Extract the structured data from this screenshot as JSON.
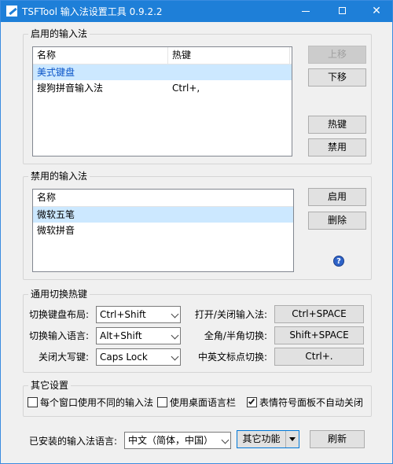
{
  "window": {
    "title": "TSFTool 输入法设置工具 0.9.2.2"
  },
  "enabled": {
    "legend": "启用的输入法",
    "columns": [
      "名称",
      "热键"
    ],
    "rows": [
      {
        "name": "美式键盘",
        "hotkey": ""
      },
      {
        "name": "搜狗拼音输入法",
        "hotkey": "Ctrl+,"
      }
    ],
    "buttons": {
      "up": "上移",
      "down": "下移",
      "hotkey": "热键",
      "disable": "禁用"
    }
  },
  "disabled": {
    "legend": "禁用的输入法",
    "column": "名称",
    "rows": [
      "微软五笔",
      "微软拼音"
    ],
    "buttons": {
      "enable": "启用",
      "delete": "删除"
    },
    "help": "?"
  },
  "hotkeys": {
    "legend": "通用切换热键",
    "left": [
      {
        "label": "切换键盘布局:",
        "value": "Ctrl+Shift"
      },
      {
        "label": "切换输入语言:",
        "value": "Alt+Shift"
      },
      {
        "label": "关闭大写键:",
        "value": "Caps Lock"
      }
    ],
    "right": [
      {
        "label": "打开/关闭输入法:",
        "value": "Ctrl+SPACE"
      },
      {
        "label": "全角/半角切换:",
        "value": "Shift+SPACE"
      },
      {
        "label": "中英文标点切换:",
        "value": "Ctrl+."
      }
    ]
  },
  "other": {
    "legend": "其它设置",
    "checkboxes": [
      {
        "label": "每个窗口使用不同的输入法",
        "checked": false
      },
      {
        "label": "使用桌面语言栏",
        "checked": false
      },
      {
        "label": "表情符号面板不自动关闭",
        "checked": true
      }
    ]
  },
  "footer": {
    "installed_label": "已安装的输入法语言:",
    "language_value": "中文（简体，中国）",
    "more_label": "其它功能",
    "refresh_label": "刷新"
  }
}
